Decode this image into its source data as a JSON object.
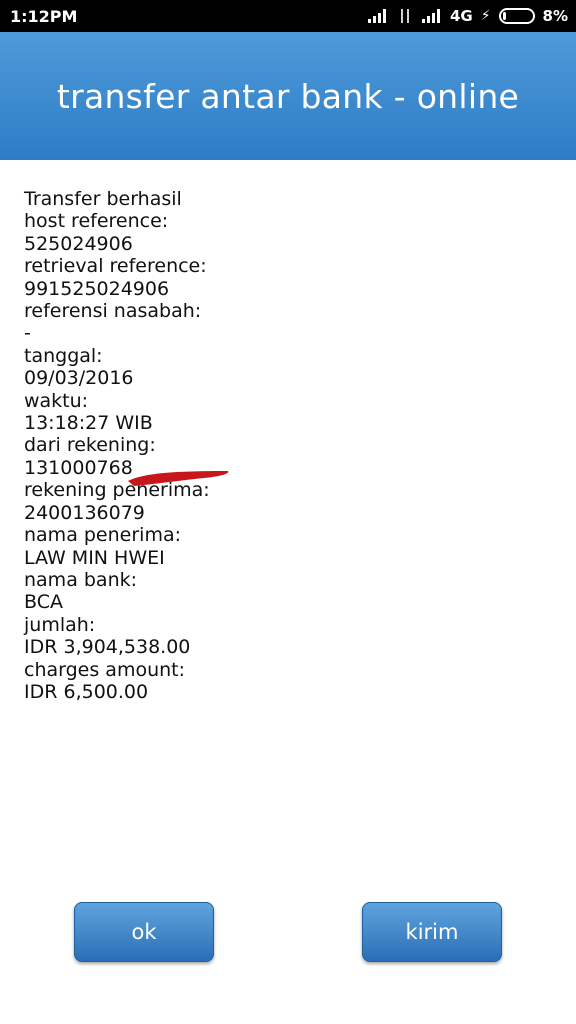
{
  "status_bar": {
    "time": "1:12PM",
    "network": "4G",
    "battery": "8%"
  },
  "header": {
    "title": "transfer antar bank - online"
  },
  "details": [
    "Transfer berhasil",
    "host reference:",
    "525024906",
    "retrieval reference:",
    "991525024906",
    "referensi nasabah:",
    "-",
    "tanggal:",
    "09/03/2016",
    "waktu:",
    "13:18:27 WIB",
    "dari rekening:",
    "131000768",
    "rekening penerima:",
    "2400136079",
    "nama penerima:",
    "LAW MIN HWEI",
    "nama bank:",
    "BCA",
    "jumlah:",
    "IDR 3,904,538.00",
    "charges amount:",
    "IDR 6,500.00"
  ],
  "buttons": {
    "ok": "ok",
    "kirim": "kirim"
  },
  "colors": {
    "header_top": "#4f9ad9",
    "header_bottom": "#2d7cc6",
    "redaction": "#c8161d"
  }
}
